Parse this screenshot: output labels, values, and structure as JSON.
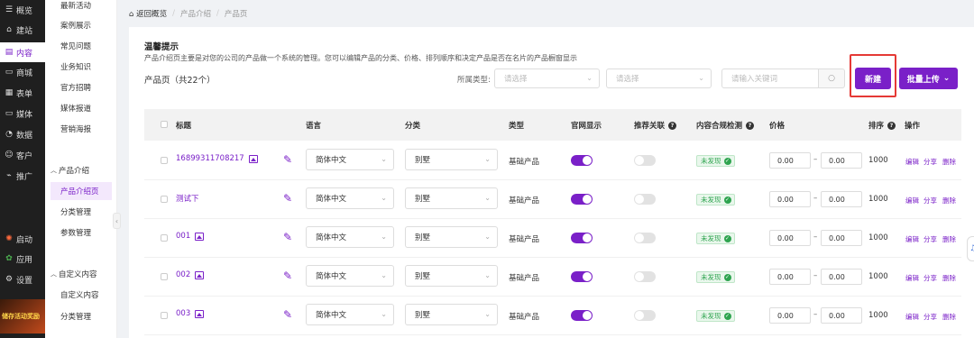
{
  "rail": {
    "items": [
      {
        "label": "概览",
        "icon": "dashboard-icon",
        "glyph": "☰"
      },
      {
        "label": "建站",
        "icon": "home-icon",
        "glyph": "⌂"
      },
      {
        "label": "内容",
        "icon": "document-icon",
        "glyph": "▤"
      },
      {
        "label": "商城",
        "icon": "store-icon",
        "glyph": "▭"
      },
      {
        "label": "表单",
        "icon": "form-icon",
        "glyph": "▦"
      },
      {
        "label": "媒体",
        "icon": "media-icon",
        "glyph": "▭"
      },
      {
        "label": "数据",
        "icon": "data-icon",
        "glyph": "◔"
      },
      {
        "label": "客户",
        "icon": "user-icon",
        "glyph": "☺"
      },
      {
        "label": "推广",
        "icon": "promote-icon",
        "glyph": "⌁"
      },
      {
        "label": "启动",
        "icon": "launch-icon",
        "glyph": "✺"
      },
      {
        "label": "应用",
        "icon": "apps-icon",
        "glyph": "✿"
      },
      {
        "label": "设置",
        "icon": "gear-icon",
        "glyph": "⚙"
      }
    ],
    "promo": "储存活动奖励"
  },
  "submenu": {
    "items": [
      "最新活动",
      "案例展示",
      "常见问题",
      "业务知识",
      "官方招聘",
      "媒体报道",
      "营销海报"
    ],
    "group1": "产品介绍",
    "group1_items": [
      "产品介绍页",
      "分类管理",
      "参数管理"
    ],
    "group2": "自定义内容",
    "group2_items": [
      "自定义内容",
      "分类管理"
    ]
  },
  "breadcrumb": [
    "返回概览",
    "产品介绍",
    "产品页"
  ],
  "tip": {
    "title": "温馨提示",
    "text": "产品介绍页主要是对您的公司的产品做一个系统的管理。您可以编辑产品的分类、价格、排列顺序和决定产品是否在名片的产品橱窗显示"
  },
  "list_title": "产品页（共22个）",
  "filters": {
    "type_label": "所属类型:",
    "select1_placeholder": "请选择",
    "select2_placeholder": "请选择",
    "search_placeholder": "请输入关键词"
  },
  "buttons": {
    "new": "新建",
    "upload": "批量上传"
  },
  "table": {
    "headers": {
      "title": "标题",
      "language": "语言",
      "category": "分类",
      "type": "类型",
      "show": "官网显示",
      "recommend": "推荐关联",
      "compliance": "内容合规检测",
      "price": "价格",
      "sort": "排序",
      "actions": "操作"
    },
    "rows": [
      {
        "title": "16899311708217",
        "language": "简体中文",
        "category": "别墅",
        "type": "基础产品",
        "show": true,
        "recommend": false,
        "status": "未发现",
        "price_min": "0.00",
        "price_max": "0.00",
        "sort": "1000"
      },
      {
        "title": "测试下",
        "language": "简体中文",
        "category": "别墅",
        "type": "基础产品",
        "show": true,
        "recommend": false,
        "status": "未发现",
        "price_min": "0.00",
        "price_max": "0.00",
        "sort": "1000"
      },
      {
        "title": "001",
        "language": "简体中文",
        "category": "别墅",
        "type": "基础产品",
        "show": true,
        "recommend": false,
        "status": "未发现",
        "price_min": "0.00",
        "price_max": "0.00",
        "sort": "1000"
      },
      {
        "title": "002",
        "language": "简体中文",
        "category": "别墅",
        "type": "基础产品",
        "show": true,
        "recommend": false,
        "status": "未发现",
        "price_min": "0.00",
        "price_max": "0.00",
        "sort": "1000"
      },
      {
        "title": "003",
        "language": "简体中文",
        "category": "别墅",
        "type": "基础产品",
        "show": true,
        "recommend": false,
        "status": "未发现",
        "price_min": "0.00",
        "price_max": "0.00",
        "sort": "1000"
      }
    ],
    "row_actions": [
      "编辑",
      "分享",
      "删除"
    ],
    "price_separator": "–"
  },
  "colors": {
    "accent": "#7a20c8",
    "highlight": "#e53935",
    "success": "#2ea44f"
  }
}
